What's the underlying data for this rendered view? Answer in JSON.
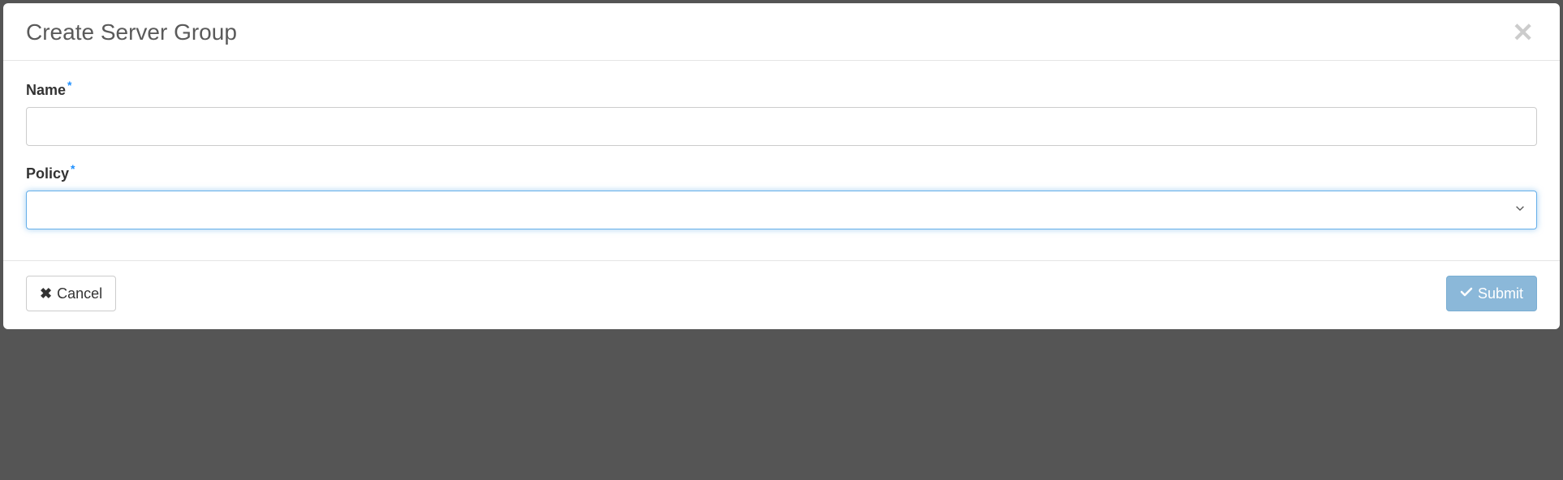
{
  "modal": {
    "title": "Create Server Group"
  },
  "form": {
    "name": {
      "label": "Name",
      "value": "",
      "required_mark": "*"
    },
    "policy": {
      "label": "Policy",
      "selected": "",
      "required_mark": "*"
    }
  },
  "footer": {
    "cancel_label": "Cancel",
    "submit_label": "Submit"
  }
}
